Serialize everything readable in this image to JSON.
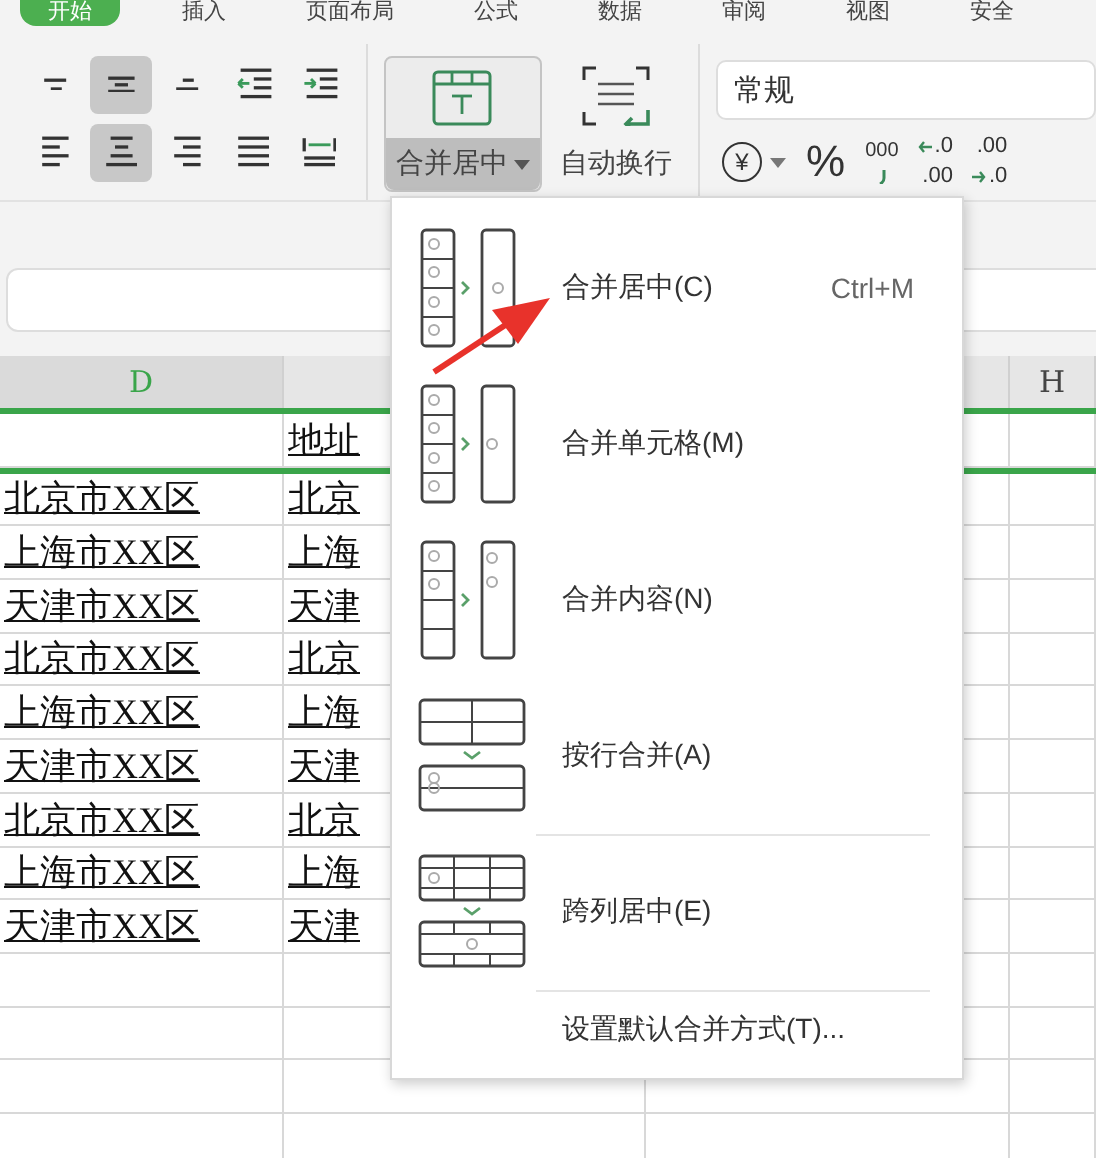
{
  "ribbon_tabs": [
    {
      "label": "开始",
      "selected": true
    },
    {
      "label": "插入",
      "selected": false
    },
    {
      "label": "页面布局",
      "selected": false
    },
    {
      "label": "公式",
      "selected": false
    },
    {
      "label": "数据",
      "selected": false
    },
    {
      "label": "审阅",
      "selected": false
    },
    {
      "label": "视图",
      "selected": false
    },
    {
      "label": "安全",
      "selected": false
    }
  ],
  "alignment_buttons": [
    {
      "kind": "align-top",
      "selected": false
    },
    {
      "kind": "align-middle",
      "selected": true
    },
    {
      "kind": "align-bottom",
      "selected": false
    },
    {
      "kind": "indent-decrease",
      "selected": false
    },
    {
      "kind": "indent-increase",
      "selected": false
    },
    {
      "kind": "align-left",
      "selected": false
    },
    {
      "kind": "align-center",
      "selected": true
    },
    {
      "kind": "align-right",
      "selected": false
    },
    {
      "kind": "justify",
      "selected": false
    },
    {
      "kind": "distribute",
      "selected": false
    }
  ],
  "merge_button": {
    "label": "合并居中",
    "pressed": true
  },
  "wrap_button": {
    "label": "自动换行"
  },
  "number_format": {
    "value": "常规"
  },
  "number_buttons": [
    {
      "kind": "currency",
      "text": "¥"
    },
    {
      "kind": "percent",
      "text": "%"
    },
    {
      "kind": "thousands",
      "text": "000"
    },
    {
      "kind": "decimal-increase",
      "top": ".0",
      "bottom": ".00"
    },
    {
      "kind": "decimal-decrease",
      "top": ".00",
      "bottom": ".0"
    }
  ],
  "sheet": {
    "columns": [
      {
        "label": "D",
        "selected": true
      },
      {
        "label": "H",
        "selected": false
      }
    ],
    "rows": [
      {
        "column_e": "地址",
        "selected": true
      },
      {
        "column_d": "北京市XX区",
        "column_e": "北京",
        "selected": false
      },
      {
        "column_d": "上海市XX区",
        "column_e": "上海",
        "selected": false
      },
      {
        "column_d": "天津市XX区",
        "column_e": "天津",
        "selected": false
      },
      {
        "column_d": "北京市XX区",
        "column_e": "北京",
        "selected": false
      },
      {
        "column_d": "上海市XX区",
        "column_e": "上海",
        "selected": false
      },
      {
        "column_d": "天津市XX区",
        "column_e": "天津",
        "selected": false
      },
      {
        "column_d": "北京市XX区",
        "column_e": "北京",
        "selected": false
      },
      {
        "column_d": "上海市XX区",
        "column_e": "上海",
        "selected": false
      },
      {
        "column_d": "天津市XX区",
        "column_e": "天津",
        "selected": false
      }
    ]
  },
  "merge_menu": {
    "items": [
      {
        "kind": "merge-center",
        "label": "合并居中(C)",
        "shortcut": "Ctrl+M",
        "separator_before": false
      },
      {
        "kind": "merge-cells",
        "label": "合并单元格(M)",
        "separator_before": false
      },
      {
        "kind": "merge-content",
        "label": "合并内容(N)",
        "separator_before": false
      },
      {
        "kind": "merge-rows",
        "label": "按行合并(A)",
        "separator_before": false
      },
      {
        "kind": "center-across",
        "label": "跨列居中(E)",
        "separator_before": true
      },
      {
        "kind": "set-default",
        "label": "设置默认合并方式(T)...",
        "separator_before": true
      }
    ]
  }
}
